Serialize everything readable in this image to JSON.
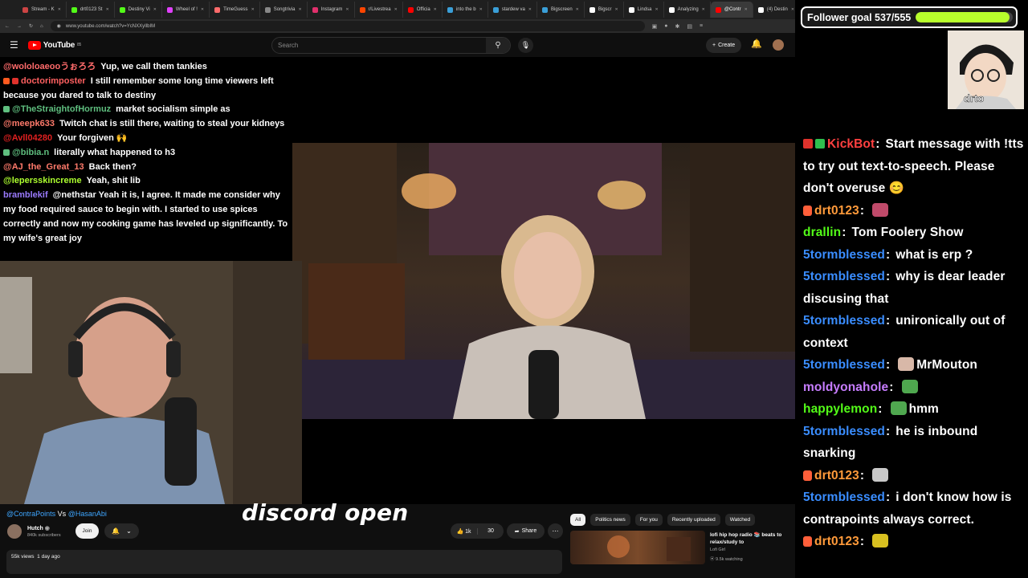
{
  "browser": {
    "tabs": [
      {
        "label": "Stream - K",
        "color": "#cc4444"
      },
      {
        "label": "drt0123 St",
        "color": "#53fc18"
      },
      {
        "label": "Destiny Vi",
        "color": "#53fc18"
      },
      {
        "label": "Wheel of !",
        "color": "#e040fb"
      },
      {
        "label": "TimeGuess",
        "color": "#ff6b6b"
      },
      {
        "label": "Songtrivia",
        "color": "#888888"
      },
      {
        "label": "Instagram",
        "color": "#e1306c"
      },
      {
        "label": "r/Livestrea",
        "color": "#ff4500"
      },
      {
        "label": "Officia",
        "color": "#ff0000"
      },
      {
        "label": "into the b",
        "color": "#3a9fd8"
      },
      {
        "label": "stardew va",
        "color": "#3a9fd8"
      },
      {
        "label": "Bigscreen",
        "color": "#3a9fd8"
      },
      {
        "label": "Bigscr",
        "color": "#ffffff"
      },
      {
        "label": "Lindsa",
        "color": "#ffffff"
      },
      {
        "label": "Analyzing",
        "color": "#ffffff"
      },
      {
        "label": "@Contr",
        "color": "#ff0000"
      },
      {
        "label": "(4) Destin",
        "color": "#ffffff"
      }
    ],
    "active_tab_index": 15,
    "url": "www.youtube.com/watch?v=YcNXXyIlbIM"
  },
  "youtube": {
    "logo_text": "YouTube",
    "logo_sup": "85",
    "search_placeholder": "Search",
    "create_label": "Create"
  },
  "yt_chat": [
    {
      "user": "@wololoaeooうぉろろ",
      "color": "#ff6b6b",
      "text": "Yup, we call them tankies"
    },
    {
      "user": "doctorimposter",
      "color": "#ff6060",
      "text": "I still remember some long time viewers left because you dared to talk to destiny",
      "badges": [
        "#ff5a1f",
        "#e0322c"
      ]
    },
    {
      "user": "@TheStraightofHormuz",
      "color": "#5fbf7f",
      "text": "market socialism simple as",
      "badges": [
        "#5fbf7f"
      ]
    },
    {
      "user": "@meepk633",
      "color": "#ff7a6b",
      "text": "Twitch chat is still there, waiting to steal your kidneys"
    },
    {
      "user": "@Avll04280",
      "color": "#e02020",
      "text": "Your forgiven 🙌"
    },
    {
      "user": "@bibia.n",
      "color": "#5fbf7f",
      "text": "literally what happened to h3",
      "badges": [
        "#5fbf7f"
      ]
    },
    {
      "user": "@AJ_the_Great_13",
      "color": "#ff7a6b",
      "text": "Back then?"
    },
    {
      "user": "@lepersskincreme",
      "color": "#adff2f",
      "text": "Yeah, shit lib"
    },
    {
      "user": "bramblekif",
      "color": "#9b7bff",
      "text": "@nethstar Yeah it is, I agree. It made me consider why my food required sauce to begin with. I started to use spices correctly and now my cooking game has leveled up significantly. To my wife's great joy"
    }
  ],
  "video": {
    "caption": "discord open",
    "title_prefix": "@ContraPoints",
    "title_mid": " Vs ",
    "title_suffix": "@HasanAbi",
    "channel_name": "Hutch",
    "channel_subs": "840k subscribers",
    "join_label": "Join",
    "likes": "1k",
    "dislikes": "30",
    "share_label": "Share",
    "views": "55k views",
    "age": "1 day ago"
  },
  "rec_chips": [
    "All",
    "Politics news",
    "For you",
    "Recently uploaded",
    "Watched"
  ],
  "recommendation": {
    "title": "lofi hip hop radio 📚 beats to relax/study to",
    "channel": "Lofi Girl",
    "watching": "9.5k watching"
  },
  "follower_goal": {
    "label": "Follower goal 537/555",
    "current": 537,
    "target": 555
  },
  "streamer_label": "drto",
  "twitch_chat": [
    {
      "user": "KickBot",
      "color": "#ff4040",
      "text": "Start message with !tts to try out text-to-speech. Please don't overuse 😊",
      "badges": [
        "#e0322c",
        "#2fbf4f"
      ]
    },
    {
      "user": "drt0123",
      "color": "#ff9a3a",
      "text": "",
      "mic": true,
      "emote": "#c04a6a"
    },
    {
      "user": "drallin",
      "color": "#53fc18",
      "text": "Tom Foolery Show"
    },
    {
      "user": "5tormblessed",
      "color": "#3a8dff",
      "text": "what is erp ?"
    },
    {
      "user": "5tormblessed",
      "color": "#3a8dff",
      "text": "why is dear leader discusing that"
    },
    {
      "user": "5tormblessed",
      "color": "#3a8dff",
      "text": "unironically out of context"
    },
    {
      "user": "5tormblessed",
      "color": "#3a8dff",
      "text": "MrMouton",
      "emote": "#d8b8a8"
    },
    {
      "user": "moldyonahole",
      "color": "#c77dff",
      "text": "",
      "emote": "#4fa84f"
    },
    {
      "user": "happylemon",
      "color": "#53fc18",
      "text": "hmm",
      "emote": "#4fa84f"
    },
    {
      "user": "5tormblessed",
      "color": "#3a8dff",
      "text": "he is inbound snarking"
    },
    {
      "user": "drt0123",
      "color": "#ff9a3a",
      "text": "",
      "mic": true,
      "emote": "#c8c8c8"
    },
    {
      "user": "5tormblessed",
      "color": "#3a8dff",
      "text": "i don't know how is contrapoints always correct."
    },
    {
      "user": "drt0123",
      "color": "#ff9a3a",
      "text": "",
      "mic": true,
      "emote": "#d8c020"
    }
  ]
}
